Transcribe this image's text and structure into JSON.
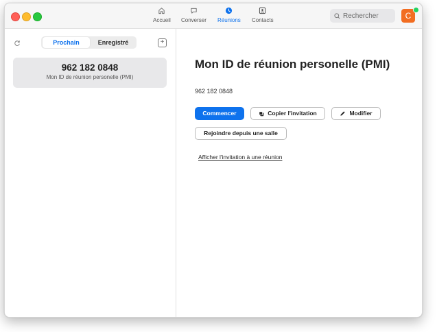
{
  "titlebar": {
    "nav": [
      {
        "label": "Accueil",
        "icon": "home-icon",
        "active": false
      },
      {
        "label": "Converser",
        "icon": "chat-icon",
        "active": false
      },
      {
        "label": "Réunions",
        "icon": "clock-icon",
        "active": true
      },
      {
        "label": "Contacts",
        "icon": "contact-card-icon",
        "active": false
      }
    ],
    "search_placeholder": "Rechercher",
    "avatar_initial": "C",
    "accent_color": "#0e72ed",
    "avatar_color": "#f26d21",
    "presence_color": "#23d160"
  },
  "sidebar": {
    "tabs": [
      "Prochain",
      "Enregistré"
    ],
    "selected_tab": "Prochain",
    "meeting": {
      "id": "962 182 0848",
      "name": "Mon ID de réunion personelle (PMI)"
    }
  },
  "main": {
    "title": "Mon ID de réunion personelle (PMI)",
    "meeting_id": "962 182 0848",
    "buttons": {
      "start": "Commencer",
      "copy": "Copier l'invitation",
      "edit": "Modifier",
      "room": "Rejoindre depuis une salle"
    },
    "invite_link": "Afficher l'invitation à une réunion"
  }
}
